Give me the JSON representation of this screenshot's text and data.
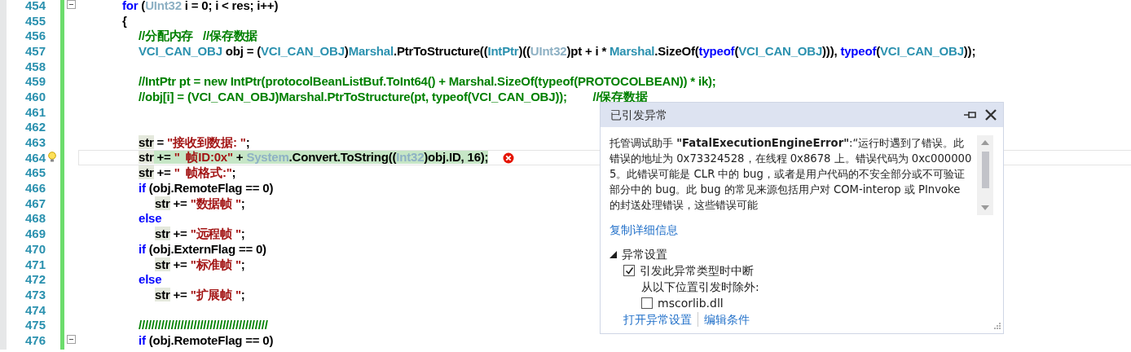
{
  "editor": {
    "lines": [
      {
        "number": "454",
        "collapsible": true,
        "tokens": [
          {
            "kind": "keyword",
            "text": "for"
          },
          {
            "kind": "plain",
            "text": " ("
          },
          {
            "kind": "faded",
            "text": "UInt32"
          },
          {
            "kind": "plain",
            "text": " i = 0; i < res; i++)"
          }
        ]
      },
      {
        "number": "455",
        "tokens": [
          {
            "kind": "plain",
            "text": "{"
          }
        ],
        "children": [
          {
            "number": "456",
            "tokens": [
              {
                "kind": "comment",
                "text": "//分配内存   //保存数据"
              }
            ]
          },
          {
            "number": "457",
            "tokens": [
              {
                "kind": "type",
                "text": "VCI_CAN_OBJ"
              },
              {
                "kind": "plain",
                "text": " obj = ("
              },
              {
                "kind": "type",
                "text": "VCI_CAN_OBJ"
              },
              {
                "kind": "plain",
                "text": ")"
              },
              {
                "kind": "type",
                "text": "Marshal"
              },
              {
                "kind": "plain",
                "text": ".PtrToStructure(("
              },
              {
                "kind": "type",
                "text": "IntPtr"
              },
              {
                "kind": "plain",
                "text": ")(("
              },
              {
                "kind": "faded",
                "text": "UInt32"
              },
              {
                "kind": "plain",
                "text": ")pt + i * "
              },
              {
                "kind": "type",
                "text": "Marshal"
              },
              {
                "kind": "plain",
                "text": ".SizeOf("
              },
              {
                "kind": "keyword",
                "text": "typeof"
              },
              {
                "kind": "plain",
                "text": "("
              },
              {
                "kind": "type",
                "text": "VCI_CAN_OBJ"
              },
              {
                "kind": "plain",
                "text": "))), "
              },
              {
                "kind": "keyword",
                "text": "typeof"
              },
              {
                "kind": "plain",
                "text": "("
              },
              {
                "kind": "type",
                "text": "VCI_CAN_OBJ"
              },
              {
                "kind": "plain",
                "text": "));"
              }
            ]
          },
          {
            "number": "458"
          },
          {
            "number": "459",
            "tokens": [
              {
                "kind": "comment",
                "text": "//IntPtr pt = new IntPtr(protocolBeanListBuf.ToInt64() + Marshal.SizeOf(typeof(PROTOCOLBEAN)) * ik);"
              }
            ]
          },
          {
            "number": "460",
            "tokens": [
              {
                "kind": "comment",
                "text": "//obj[i] = (VCI_CAN_OBJ)Marshal.PtrToStructure(pt, typeof(VCI_CAN_OBJ));        //保存数据"
              }
            ]
          },
          {
            "number": "461"
          },
          {
            "number": "462"
          },
          {
            "number": "463",
            "tokens": [
              {
                "kind": "ref",
                "text": "str"
              },
              {
                "kind": "plain",
                "text": " = "
              },
              {
                "kind": "string",
                "text": "\"接收到数据: \""
              },
              {
                "kind": "plain",
                "text": ";"
              }
            ]
          },
          {
            "number": "464",
            "current": true,
            "error": true,
            "tokens": [
              {
                "kind": "ref",
                "text": "str"
              },
              {
                "kind": "plain",
                "text": " += "
              },
              {
                "kind": "string",
                "text": "\"  帧ID:0x\""
              },
              {
                "kind": "plain",
                "text": " + "
              },
              {
                "kind": "faded",
                "text": "System"
              },
              {
                "kind": "plain",
                "text": ".Convert.ToString(("
              },
              {
                "kind": "faded",
                "text": "Int32"
              },
              {
                "kind": "plain",
                "text": ")obj.ID, 16);"
              }
            ]
          },
          {
            "number": "465",
            "tokens": [
              {
                "kind": "ref",
                "text": "str"
              },
              {
                "kind": "plain",
                "text": " += "
              },
              {
                "kind": "string",
                "text": "\"  帧格式:\""
              },
              {
                "kind": "plain",
                "text": ";"
              }
            ]
          },
          {
            "number": "466",
            "tokens": [
              {
                "kind": "keyword",
                "text": "if"
              },
              {
                "kind": "plain",
                "text": " (obj.RemoteFlag == 0)"
              }
            ],
            "children": [
              {
                "number": "467",
                "tokens": [
                  {
                    "kind": "ref",
                    "text": "str"
                  },
                  {
                    "kind": "plain",
                    "text": " += "
                  },
                  {
                    "kind": "string",
                    "text": "\"数据帧 \""
                  },
                  {
                    "kind": "plain",
                    "text": ";"
                  }
                ]
              }
            ]
          },
          {
            "number": "468",
            "tokens": [
              {
                "kind": "keyword",
                "text": "else"
              }
            ],
            "children": [
              {
                "number": "469",
                "tokens": [
                  {
                    "kind": "ref",
                    "text": "str"
                  },
                  {
                    "kind": "plain",
                    "text": " += "
                  },
                  {
                    "kind": "string",
                    "text": "\"远程帧 \""
                  },
                  {
                    "kind": "plain",
                    "text": ";"
                  }
                ]
              }
            ]
          },
          {
            "number": "470",
            "tokens": [
              {
                "kind": "keyword",
                "text": "if"
              },
              {
                "kind": "plain",
                "text": " (obj.ExternFlag == 0)"
              }
            ],
            "children": [
              {
                "number": "471",
                "tokens": [
                  {
                    "kind": "ref",
                    "text": "str"
                  },
                  {
                    "kind": "plain",
                    "text": " += "
                  },
                  {
                    "kind": "string",
                    "text": "\"标准帧 \""
                  },
                  {
                    "kind": "plain",
                    "text": ";"
                  }
                ]
              }
            ]
          },
          {
            "number": "472",
            "tokens": [
              {
                "kind": "keyword",
                "text": "else"
              }
            ],
            "children": [
              {
                "number": "473",
                "tokens": [
                  {
                    "kind": "ref",
                    "text": "str"
                  },
                  {
                    "kind": "plain",
                    "text": " += "
                  },
                  {
                    "kind": "string",
                    "text": "\"扩展帧 \""
                  },
                  {
                    "kind": "plain",
                    "text": ";"
                  }
                ]
              }
            ]
          },
          {
            "number": "474"
          },
          {
            "number": "475",
            "tokens": [
              {
                "kind": "comment",
                "text": "////////////////////////////////////////"
              }
            ]
          },
          {
            "number": "476",
            "collapsible": true,
            "tokens": [
              {
                "kind": "keyword",
                "text": "if"
              },
              {
                "kind": "plain",
                "text": " (obj.RemoteFlag == 0)"
              }
            ]
          }
        ]
      }
    ]
  },
  "exception_popup": {
    "title": "已引发异常",
    "message": "托管调试助手 **\"FatalExecutionEngineError\"**:“运行时遇到了错误。此错误的地址为 0x73324528，在线程 0x8678 上。错误代码为 0xc0000005。此错误可能是 CLR 中的 bug，或者是用户代码的不安全部分或不可验证部分中的 bug。此 bug 的常见来源包括用户对 COM-interop 或 PInvoke 的封送处理错误，这些错误可能",
    "copy_link": "复制详细信息",
    "settings": {
      "title": "异常设置",
      "expanded": true,
      "break_option": {
        "label": "引发此异常类型时中断",
        "checked": true
      },
      "except_label": "从以下位置引发时除外:",
      "modules": [
        {
          "label": "mscorlib.dll",
          "checked": false
        }
      ]
    },
    "links": [
      "打开异常设置",
      "编辑条件"
    ]
  }
}
